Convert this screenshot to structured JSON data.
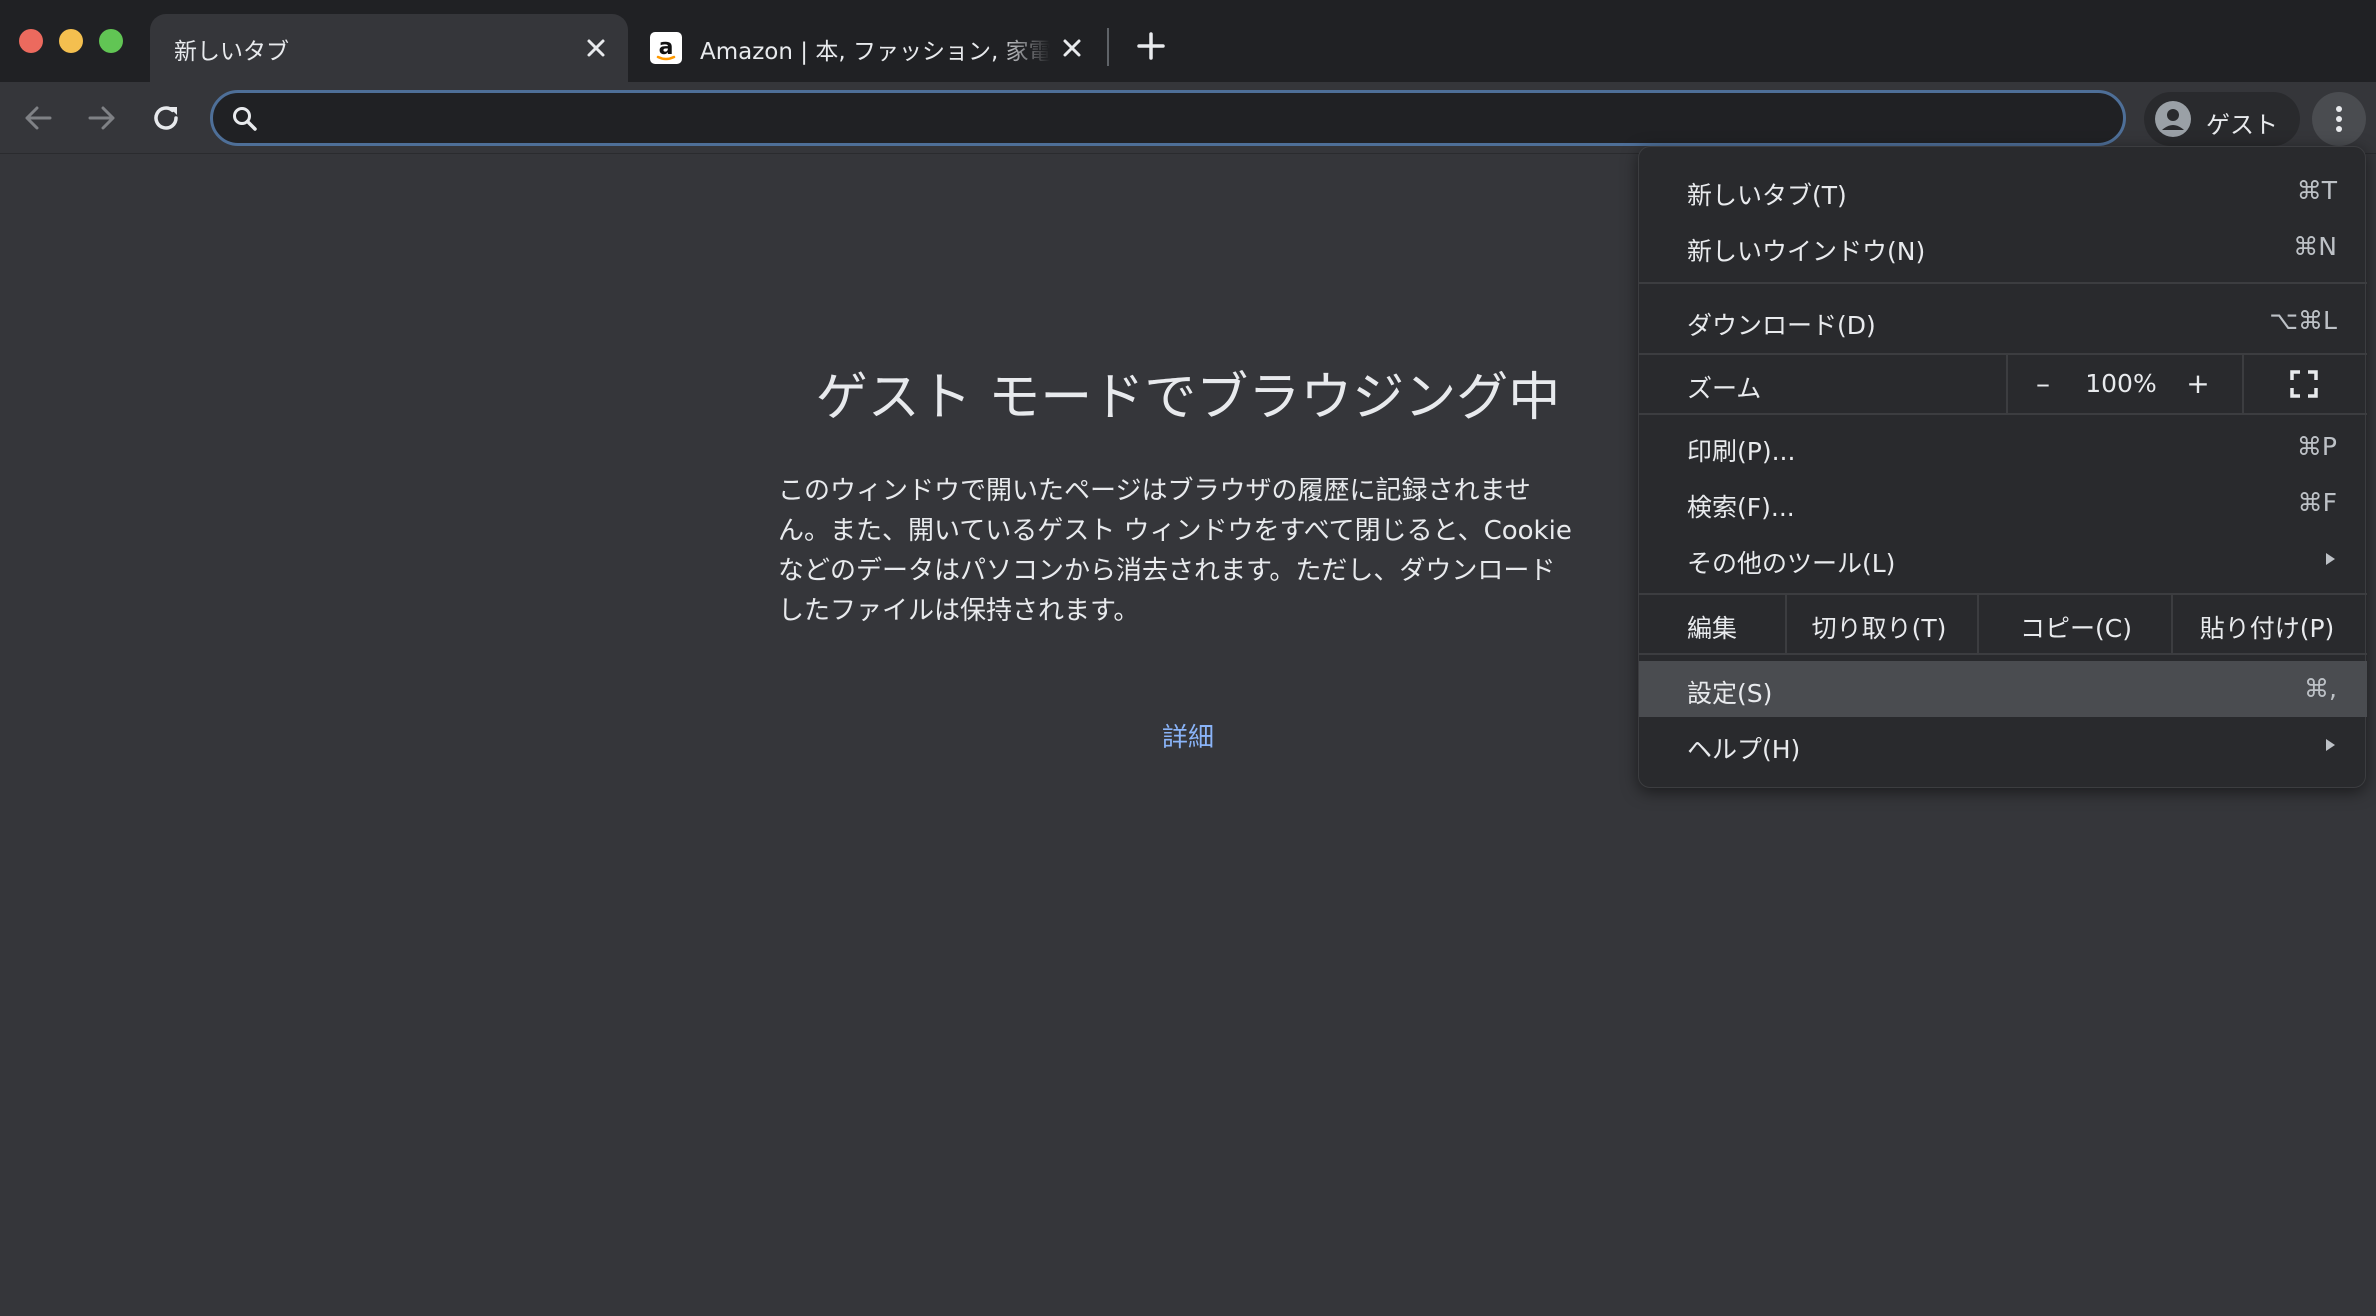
{
  "window": {
    "controls": [
      "close",
      "minimize",
      "zoom"
    ]
  },
  "tabs": [
    {
      "title": "新しいタブ",
      "active": true
    },
    {
      "title": "Amazon | 本, ファッション, 家電から食品まで",
      "active": false,
      "favicon": "amazon-icon"
    }
  ],
  "toolbar": {
    "omnibox": {
      "value": "",
      "placeholder": ""
    },
    "profile_label": "ゲスト"
  },
  "content": {
    "title": "ゲスト モードでブラウジング中",
    "body": "このウィンドウで開いたページはブラウザの履歴に記録されません。また、開いているゲスト ウィンドウをすべて閉じると、Cookie などのデータはパソコンから消去されます。ただし、ダウンロードしたファイルは保持されます。",
    "link": "詳細"
  },
  "menu": {
    "new_tab": {
      "label": "新しいタブ(T)",
      "shortcut": "⌘T"
    },
    "new_window": {
      "label": "新しいウインドウ(N)",
      "shortcut": "⌘N"
    },
    "downloads": {
      "label": "ダウンロード(D)",
      "shortcut": "⌥⌘L"
    },
    "zoom": {
      "label": "ズーム",
      "minus": "–",
      "value": "100%",
      "plus": "+"
    },
    "print": {
      "label": "印刷(P)...",
      "shortcut": "⌘P"
    },
    "find": {
      "label": "検索(F)...",
      "shortcut": "⌘F"
    },
    "more_tools": {
      "label": "その他のツール(L)"
    },
    "edit": {
      "label": "編集",
      "cut": "切り取り(T)",
      "copy": "コピー(C)",
      "paste": "貼り付け(P)"
    },
    "settings": {
      "label": "設定(S)",
      "shortcut": "⌘,"
    },
    "help": {
      "label": "ヘルプ(H)"
    }
  },
  "colors": {
    "tabstrip": "#202124",
    "toolbar": "#35363a",
    "omnibox_border": "#4e6f98",
    "link": "#8ab4f8",
    "menu_bg": "#292a2d",
    "menu_highlight": "#4a4c50"
  }
}
